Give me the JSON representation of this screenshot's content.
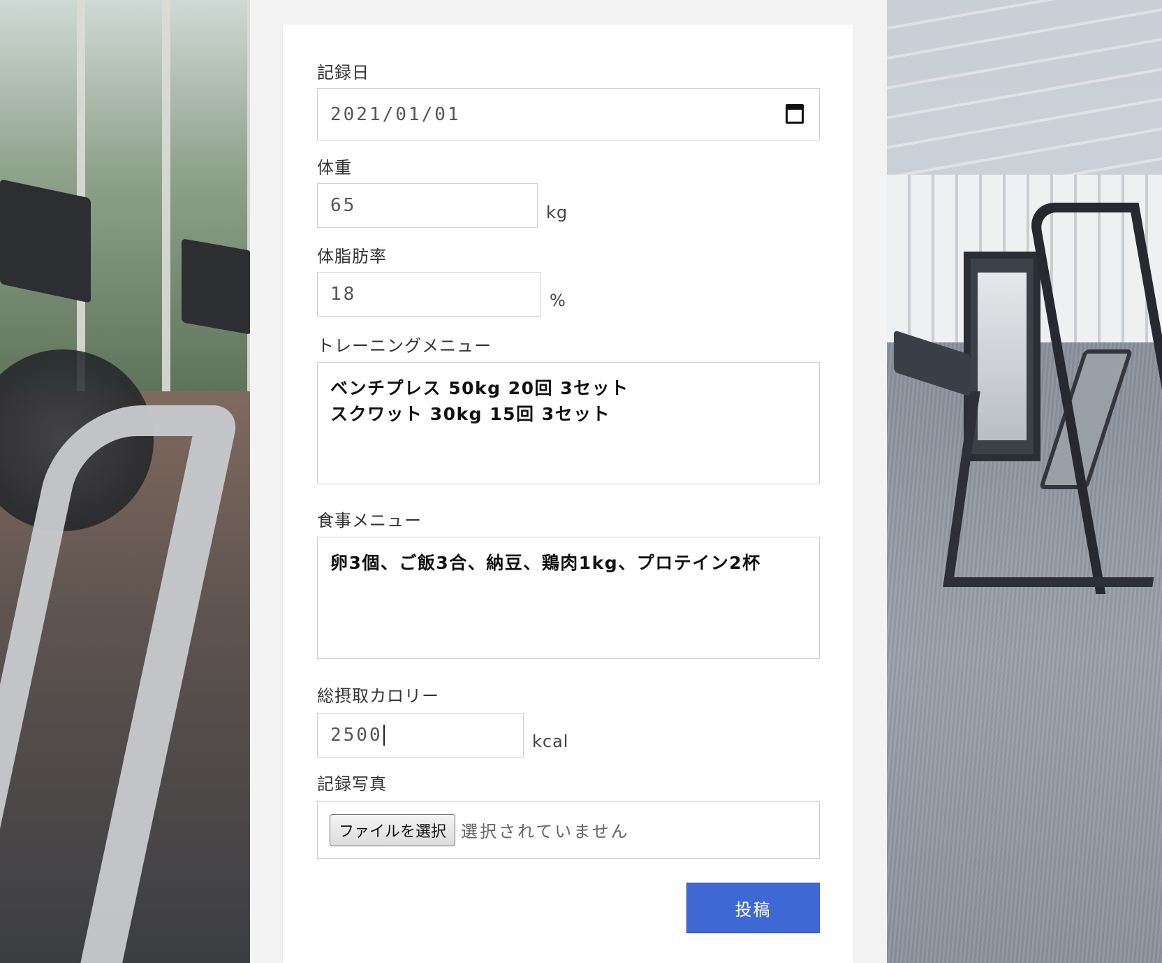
{
  "form": {
    "date": {
      "label": "記録日",
      "value": "2021/01/01"
    },
    "weight": {
      "label": "体重",
      "value": "65",
      "unit": "kg"
    },
    "body_fat": {
      "label": "体脂肪率",
      "value": "18",
      "unit": "%"
    },
    "training": {
      "label": "トレーニングメニュー",
      "value": "ベンチプレス 50kg 20回 3セット\nスクワット 30kg 15回 3セット"
    },
    "meal": {
      "label": "食事メニュー",
      "value": "卵3個、ご飯3合、納豆、鶏肉1kg、プロテイン2杯"
    },
    "calories": {
      "label": "総摂取カロリー",
      "value": "2500",
      "unit": "kcal"
    },
    "photo": {
      "label": "記録写真",
      "button_label": "ファイルを選択",
      "status": "選択されていません"
    },
    "submit_label": "投稿"
  },
  "colors": {
    "submit_bg": "#3f68d4",
    "card_bg": "#ffffff",
    "page_bg": "#f3f3f3"
  },
  "icons": {
    "date_picker": "calendar-icon"
  }
}
